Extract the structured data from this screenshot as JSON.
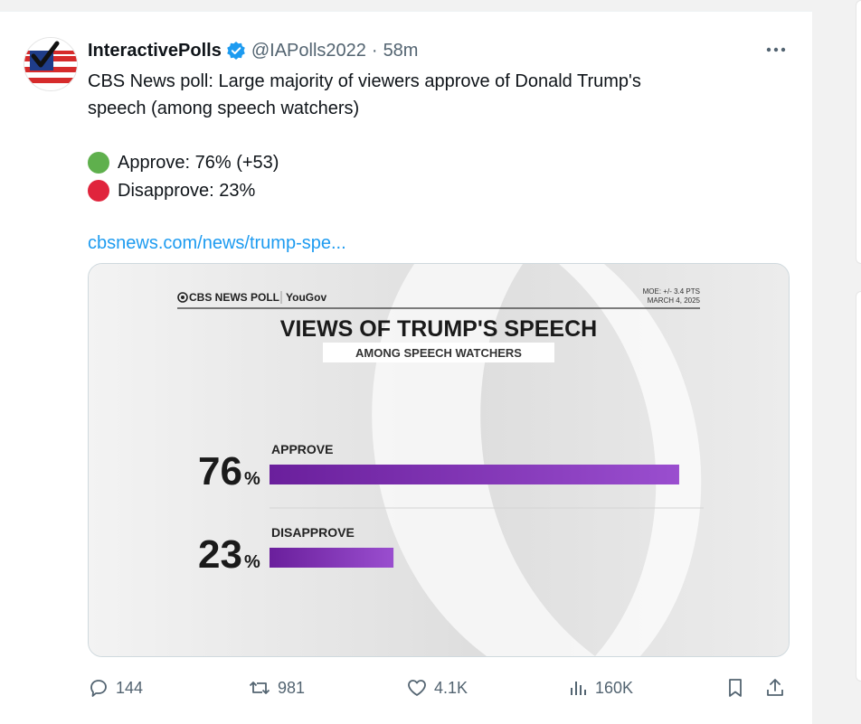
{
  "tweet": {
    "author_name": "InteractivePolls",
    "handle": "@IAPolls2022",
    "separator": "·",
    "time": "58m",
    "text_line1": "CBS News poll: Large majority of viewers approve of Donald Trump's",
    "text_line2": "speech (among speech watchers)",
    "approve_line": "Approve: 76% (+53)",
    "disapprove_line": "Disapprove: 23%",
    "link_text": "cbsnews.com/news/trump-spe..."
  },
  "colors": {
    "approve_dot": "#5fb04d",
    "disapprove_dot": "#e0243c",
    "bar": "#8b3fc0",
    "link": "#1d9bf0",
    "verified": "#1d9bf0"
  },
  "card": {
    "brand": "CBS NEWS POLL",
    "brand_partner": "YouGov",
    "moe": "MOE: +/- 3.4 PTS",
    "date": "MARCH 4, 2025",
    "title": "VIEWS OF TRUMP'S SPEECH",
    "subtitle": "AMONG SPEECH WATCHERS",
    "chart_data": {
      "type": "bar",
      "title": "VIEWS OF TRUMP'S SPEECH",
      "subtitle": "AMONG SPEECH WATCHERS",
      "categories": [
        "APPROVE",
        "DISAPPROVE"
      ],
      "values": [
        76,
        23
      ],
      "value_labels": [
        "76",
        "23"
      ],
      "unit": "%",
      "ylim": [
        0,
        100
      ]
    }
  },
  "actions": {
    "replies": "144",
    "reposts": "981",
    "likes": "4.1K",
    "views": "160K"
  }
}
